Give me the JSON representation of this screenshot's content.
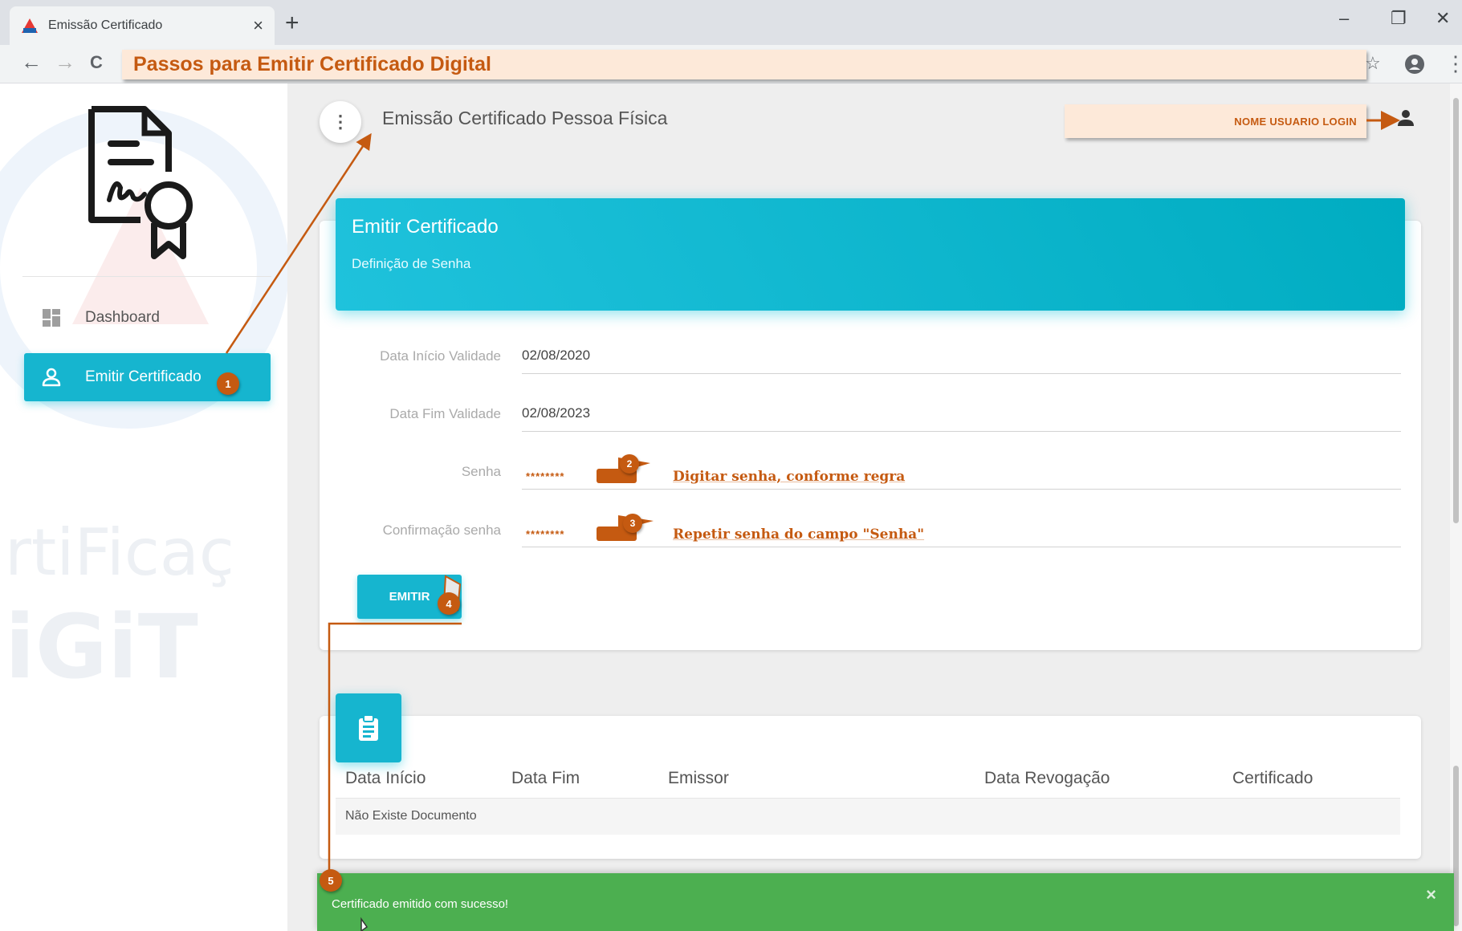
{
  "browser": {
    "tab_title": "Emissão Certificado",
    "tab_close": "×",
    "new_tab": "+",
    "address_text": "Passos para Emitir Certificado Digital",
    "controls": {
      "minimize": "–",
      "restore": "❐",
      "close": "✕"
    },
    "nav": {
      "back": "←",
      "forward": "→",
      "reload": "C"
    },
    "icons": {
      "star": "☆",
      "menu": "⋮"
    }
  },
  "sidebar": {
    "items": [
      {
        "label": "Dashboard",
        "icon": "dashboard-icon",
        "active": false
      },
      {
        "label": "Emitir Certificado",
        "icon": "person-icon",
        "active": true
      }
    ],
    "watermark": {
      "line1": "rtiFicaç",
      "line2": "iGiT"
    }
  },
  "header": {
    "menu_icon": "⋮",
    "title": "Emissão Certificado Pessoa Física",
    "user_callout": "NOME USUARIO LOGIN"
  },
  "form_card": {
    "title": "Emitir Certificado",
    "subtitle": "Definição de Senha",
    "fields": [
      {
        "label": "Data Início Validade",
        "value": "02/08/2020"
      },
      {
        "label": "Data Fim Validade",
        "value": "02/08/2023"
      },
      {
        "label": "Senha",
        "value": "********",
        "hint": "Digitar senha, conforme regra"
      },
      {
        "label": "Confirmação senha",
        "value": "********",
        "hint": "Repetir senha do campo \"Senha\""
      }
    ],
    "submit_label": "EMITIR"
  },
  "table": {
    "columns": [
      "Data Início",
      "Data Fim",
      "Emissor",
      "Data Revogação",
      "Certificado"
    ],
    "empty_text": "Não Existe Documento"
  },
  "toast": {
    "message": "Certificado emitido com sucesso!",
    "close": "×"
  },
  "annotations": {
    "steps": [
      "1",
      "2",
      "3",
      "4",
      "5"
    ]
  },
  "colors": {
    "accent": "#16b5cf",
    "annotation": "#c55a11",
    "callout_bg": "#fde9d9",
    "success": "#4caf50"
  }
}
